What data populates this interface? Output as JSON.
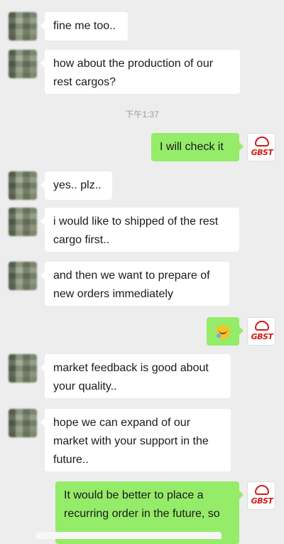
{
  "chat": {
    "timestamp": "下午1:37",
    "brand_logo_text": "GBST",
    "messages": [
      {
        "side": "in",
        "text": "fine me too.."
      },
      {
        "side": "in",
        "text": "how about the production of our rest cargos?"
      },
      {
        "side": "out",
        "text": "I will check it"
      },
      {
        "side": "in",
        "text": "yes.. plz.."
      },
      {
        "side": "in",
        "text": "i would like to shipped of the rest cargo first.."
      },
      {
        "side": "in",
        "text": "and then we want to prepare of new orders immediately"
      },
      {
        "side": "out",
        "emoji": "laughing-crying-emoji"
      },
      {
        "side": "in",
        "text": "market feedback is good about your quality.."
      },
      {
        "side": "in",
        "text": "hope we can expand of our market with your support in the future.."
      },
      {
        "side": "out",
        "text": "It would be better to place a recurring order in the future, so"
      }
    ]
  }
}
